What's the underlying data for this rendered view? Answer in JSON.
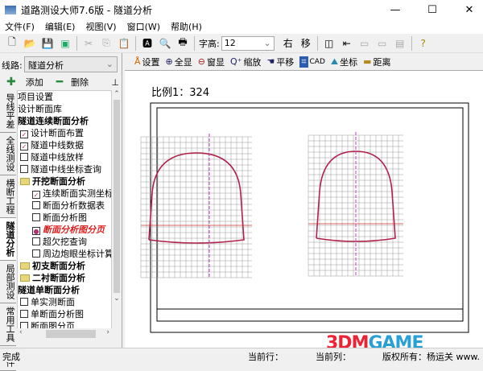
{
  "window": {
    "title": "道路测设大师7.6版 - 隧道分析",
    "minimize": "—",
    "maximize": "☐",
    "close": "✕"
  },
  "menu": [
    "文件(F)",
    "编辑(E)",
    "视图(V)",
    "窗口(W)",
    "帮助(H)"
  ],
  "toolbar": {
    "font_height_label": "字高:",
    "font_height_value": "12",
    "right_label": "右",
    "move_label": "移"
  },
  "sidebar": {
    "route_label": "线路:",
    "route_value": "隧道分析",
    "add_label": "添加",
    "delete_label": "删除",
    "tabs": [
      "导线平差",
      "全线测设",
      "横断工程",
      "隧道分析",
      "局部测设",
      "常用工具",
      "软件"
    ],
    "tree": [
      {
        "label": "项目设置",
        "type": "plain"
      },
      {
        "label": "设计断面库",
        "type": "plain"
      },
      {
        "label": "隧道连续断面分析",
        "type": "bold"
      },
      {
        "label": "设计断面布置",
        "type": "check",
        "checked": true
      },
      {
        "label": "隧道中线数据",
        "type": "check",
        "checked": true
      },
      {
        "label": "隧道中线放样",
        "type": "check",
        "checked": false
      },
      {
        "label": "隧道中线坐标查询",
        "type": "check",
        "checked": false
      },
      {
        "label": "开挖断面分析",
        "type": "folder"
      },
      {
        "label": "连续断面实测坐标",
        "type": "check",
        "checked": true,
        "indent": true
      },
      {
        "label": "断面分析数据表",
        "type": "check",
        "checked": false,
        "indent": true
      },
      {
        "label": "断面分析图",
        "type": "check",
        "checked": false,
        "indent": true
      },
      {
        "label": "断面分析图分页",
        "type": "active",
        "indent": true
      },
      {
        "label": "超欠挖查询",
        "type": "check",
        "checked": false,
        "indent": true
      },
      {
        "label": "周边炮眼坐标计算",
        "type": "check",
        "checked": false,
        "indent": true
      },
      {
        "label": "初支断面分析",
        "type": "folder"
      },
      {
        "label": "二衬断面分析",
        "type": "folder"
      },
      {
        "label": "隧道单断面分析",
        "type": "bold"
      },
      {
        "label": "单实测断面",
        "type": "check",
        "checked": false
      },
      {
        "label": "单断面分析图",
        "type": "check",
        "checked": false
      },
      {
        "label": "断面图分页",
        "type": "check",
        "checked": false
      }
    ]
  },
  "drawing_toolbar": [
    "设置",
    "全显",
    "窗显",
    "缩放",
    "平移",
    "CAD",
    "坐标",
    "距离"
  ],
  "drawing": {
    "scale": "比例1：324"
  },
  "status": {
    "left": "完成",
    "row": "当前行：",
    "col": "当前列：",
    "copyright": "版权所有：杨运关 www."
  },
  "watermark": "3DMGAME"
}
